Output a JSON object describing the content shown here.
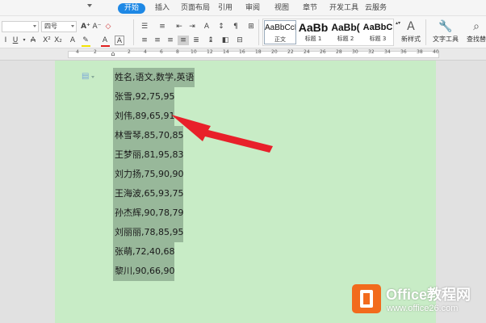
{
  "menu": {
    "items": [
      "开始",
      "插入",
      "页面布局",
      "引用",
      "审阅",
      "视图",
      "章节",
      "开发工具",
      "云服务"
    ],
    "active_index": 0
  },
  "toolbar": {
    "font_name": "",
    "font_size": "四号",
    "styles": [
      {
        "sample": "AaBbCcI",
        "label": "正文"
      },
      {
        "sample": "AaBb",
        "label": "标题 1"
      },
      {
        "sample": "AaBb(",
        "label": "标题 2"
      },
      {
        "sample": "AaBbC",
        "label": "标题 3"
      }
    ],
    "new_style": "新样式",
    "text_tools": "文字工具",
    "find_replace": "查找替"
  },
  "ruler": {
    "numbers": [
      "4",
      "2",
      "2",
      "4",
      "6",
      "8",
      "10",
      "12",
      "14",
      "16",
      "18",
      "20",
      "22",
      "24",
      "26",
      "28",
      "30",
      "32",
      "34",
      "36",
      "38",
      "40"
    ]
  },
  "document": {
    "lines": [
      "姓名,语文,数学,英语",
      "张雪,92,75,95",
      "刘伟,89,65,91",
      "林雪琴,85,70,85",
      "王梦丽,81,95,83",
      "刘力扬,75,90,90",
      "王海波,65,93,75",
      "孙杰辉,90,78,79",
      "刘丽丽,78,85,95",
      "张萌,72,40,68",
      "黎川,90,66,90"
    ]
  },
  "watermark": {
    "title": "Office教程网",
    "url": "www.office26.com"
  },
  "colors": {
    "accent": "#1e88e5",
    "page_bg": "#c8ecc6",
    "selection": "#98b89a",
    "arrow": "#e8202a",
    "logo": "#f26b1d"
  }
}
